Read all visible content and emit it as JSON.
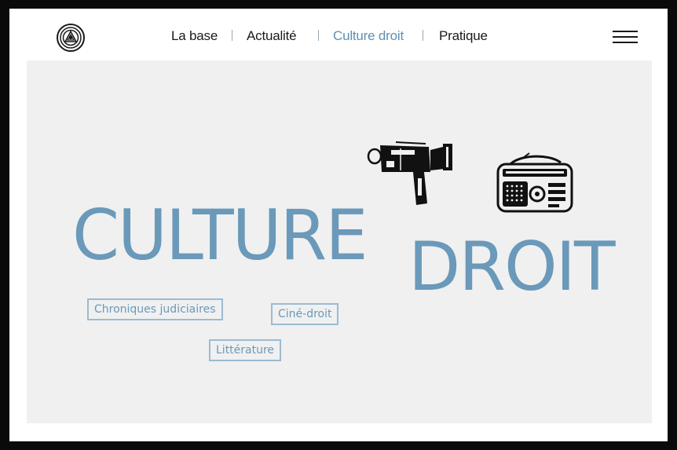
{
  "nav": {
    "items": [
      {
        "label": "La base",
        "active": false
      },
      {
        "label": "Actualité",
        "active": false
      },
      {
        "label": "Culture droit",
        "active": true
      },
      {
        "label": "Pratique",
        "active": false
      }
    ]
  },
  "hero": {
    "title_word_1": "CULTURE",
    "title_word_2": "DROIT",
    "tags": [
      "Chroniques judiciaires",
      "Ciné-droit",
      "Littérature"
    ]
  },
  "colors": {
    "accent": "#6a99ba",
    "text": "#1a1a1a",
    "hero_bg": "#f0f0f0",
    "frame": "#0a0a0a"
  },
  "icons": [
    "site-logo-icon",
    "hamburger-menu-icon",
    "movie-camera-icon",
    "radio-icon"
  ]
}
